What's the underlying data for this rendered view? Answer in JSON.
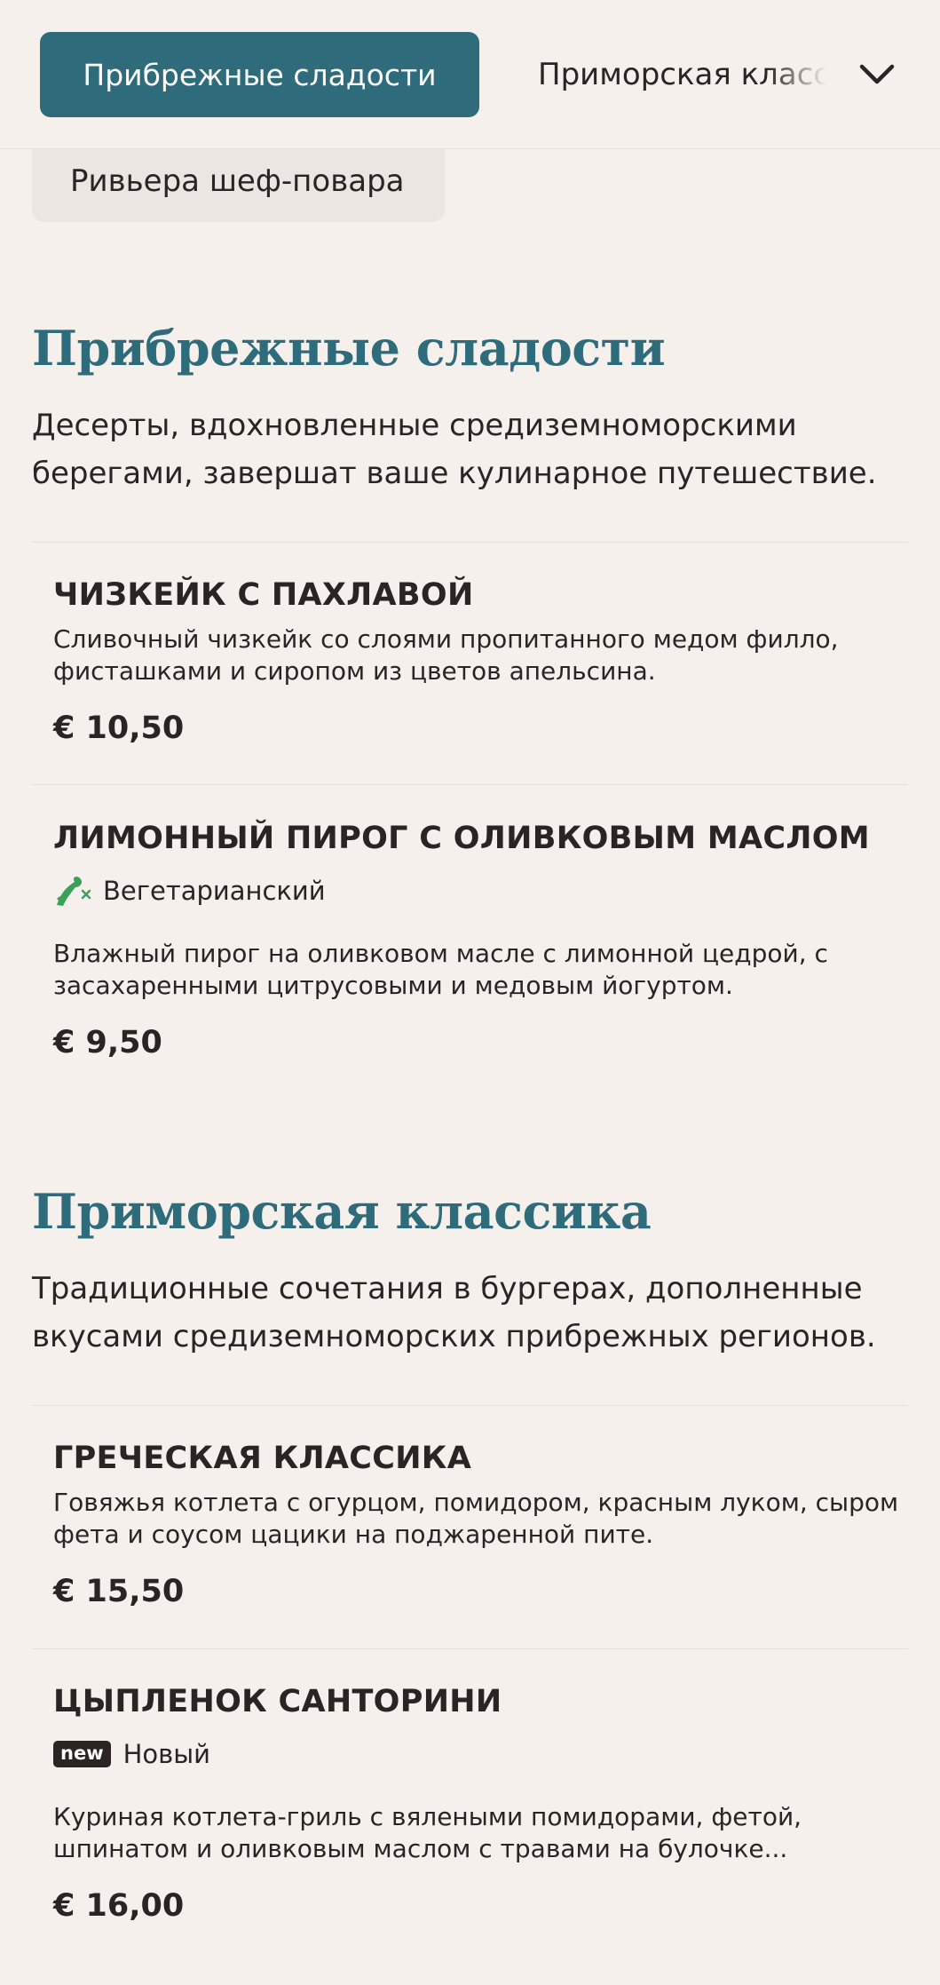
{
  "tabs": {
    "active_label": "Прибрежные сладости",
    "next_label": "Приморская классика",
    "chip_label": "Ривьера шеф-повара"
  },
  "sections": [
    {
      "title": "Прибрежные сладости",
      "description": "Десерты, вдохновленные средиземноморскими берегами, завершат ваше кулинарное путешествие.",
      "items": [
        {
          "name": "ЧИЗКЕЙК С ПАХЛАВОЙ",
          "description": "Сливочный чизкейк со слоями пропитанного медом филло, фисташками и сиропом из цветов апельсина.",
          "price": "€ 10,50"
        },
        {
          "name": "ЛИМОННЫЙ ПИРОГ С ОЛИВКОВЫМ МАСЛОМ",
          "tag": "Вегетарианский",
          "tag_icon": "vegetarian-leaf-icon",
          "description": "Влажный пирог на оливковом масле с лимонной цедрой, с засахаренными цитрусовыми и медовым йогуртом.",
          "price": "€ 9,50"
        }
      ]
    },
    {
      "title": "Приморская классика",
      "description": "Традиционные сочетания в бургерах, дополненные вкусами средиземноморских прибрежных регионов.",
      "items": [
        {
          "name": "ГРЕЧЕСКАЯ КЛАССИКА",
          "description": "Говяжья котлета с огурцом, помидором, красным луком, сыром фета и соусом цацики на поджаренной пите.",
          "price": "€ 15,50"
        },
        {
          "name": "ЦЫПЛЕНОК САНТОРИНИ",
          "badge": "new",
          "tag": "Новый",
          "description": "Куриная котлета-гриль с вялеными помидорами, фетой, шпинатом и оливковым маслом с травами на булочке...",
          "price": "€ 16,00"
        }
      ]
    }
  ],
  "colors": {
    "accent": "#2e6c7c",
    "background": "#f6f0ec",
    "chip_background": "#ebe6e1",
    "vegetarian_green": "#3aa05a"
  }
}
